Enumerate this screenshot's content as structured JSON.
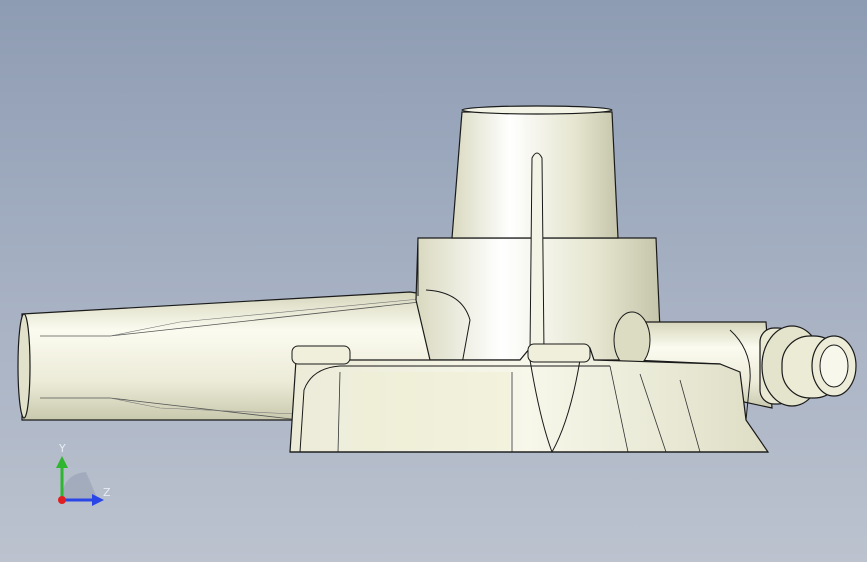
{
  "viewport": {
    "background_top": "#8e9cb3",
    "background_bottom": "#bcc3cf"
  },
  "model": {
    "body_color": "#e8e8d2",
    "shade_color": "#cfcfb6",
    "edge_color": "#1a1a1a"
  },
  "triad": {
    "y_label": "Y",
    "z_label": "Z",
    "y_color": "#2fb52f",
    "z_color": "#2b46e6",
    "x_color": "#e02020"
  }
}
